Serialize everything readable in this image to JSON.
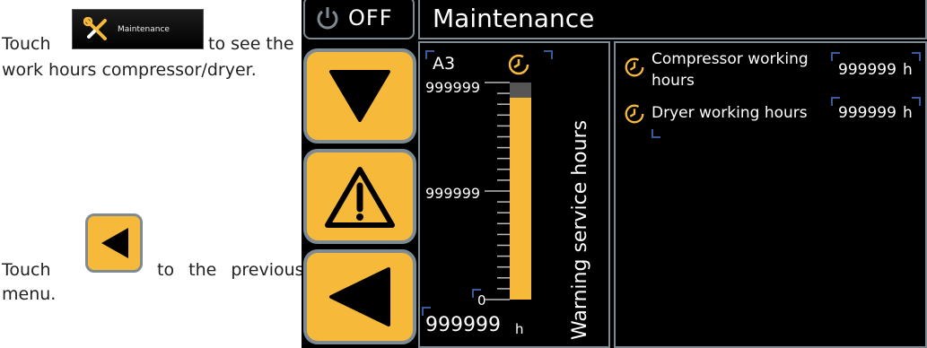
{
  "manual": {
    "touch_word_1": "Touch",
    "maintenance_button_label": "Maintenance",
    "line1_suffix": "to see the",
    "line2": "work hours compressor/dryer.",
    "touch_word_2": "Touch",
    "line3_suffix": "to the previous",
    "line4": "menu."
  },
  "screen": {
    "power_button_label": "OFF",
    "header_title": "Maintenance",
    "gauge": {
      "id_label": "A3",
      "top_value": "999999",
      "mid_value": "999999",
      "bottom_value": "0",
      "total_value": "999999",
      "unit": "h",
      "warning_label": "Warning service hours",
      "fill_fraction": 0.93
    },
    "rows": [
      {
        "label_line1": "Compressor working",
        "label_line2": "hours",
        "value": "999999",
        "unit": "h"
      },
      {
        "label_line1": "Dryer working hours",
        "label_line2": "",
        "value": "999999",
        "unit": "h"
      }
    ]
  },
  "colors": {
    "accent": "#f6b93a",
    "border": "#7e8b93",
    "bracket": "#3a5a9a",
    "background": "#000000"
  },
  "icons": [
    "wrench-screwdriver-icon",
    "back-arrow-icon",
    "power-icon",
    "down-arrow-icon",
    "warning-icon",
    "clock-icon"
  ]
}
